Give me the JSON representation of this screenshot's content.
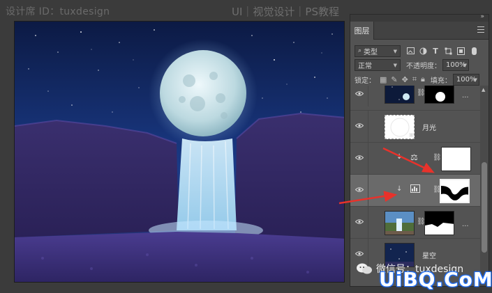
{
  "watermark": {
    "left": "设计席 ID：tuxdesign",
    "right": "UI｜视觉设计｜PS教程",
    "wechat": "微信号：tuxdesign",
    "site": "UiBQ.CoM"
  },
  "panel": {
    "tab": "图层",
    "filter_label": "类型",
    "blend_mode": "正常",
    "opacity_label": "不透明度：",
    "opacity_value": "100%",
    "lock_label": "锁定：",
    "fill_label": "填充：",
    "fill_value": "100%",
    "icons": {
      "menu": "panel-menu-icon",
      "collapse": "double-chevron-icon",
      "filter_image": "image-filter-icon",
      "filter_adjust": "adjustment-filter-icon",
      "filter_text": "text-filter-icon",
      "filter_shape": "shape-filter-icon",
      "filter_smart": "smart-object-filter-icon"
    },
    "layers": [
      {
        "name": "",
        "more": "...",
        "type": "masked-image"
      },
      {
        "name": "月光",
        "type": "smart-object"
      },
      {
        "name": "",
        "type": "balance-adjustment"
      },
      {
        "name": "",
        "type": "levels-adjustment",
        "selected": true
      },
      {
        "name": "",
        "more": "...",
        "type": "masked-image"
      },
      {
        "name": "星空",
        "type": "image"
      }
    ]
  },
  "colors": {
    "background": "#3b3b3b",
    "panel": "#535353",
    "arrow": "#e8322b",
    "accent": "#1d6fff"
  }
}
